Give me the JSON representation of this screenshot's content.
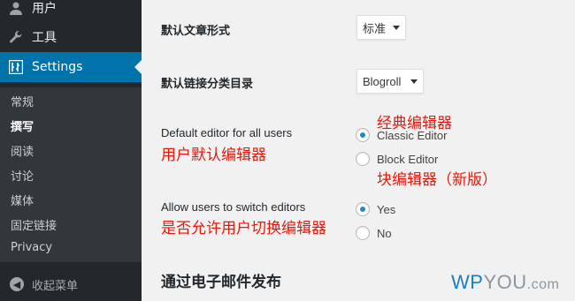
{
  "sidebar": {
    "menu": [
      {
        "label": "用户",
        "icon": "user-icon"
      },
      {
        "label": "工具",
        "icon": "wrench-icon"
      },
      {
        "label": "Settings",
        "icon": "settings-icon"
      }
    ],
    "submenu": [
      "常规",
      "撰写",
      "阅读",
      "讨论",
      "媒体",
      "固定链接",
      "Privacy"
    ],
    "current_submenu": "撰写",
    "collapse_label": "收起菜单"
  },
  "form": {
    "post_format": {
      "label": "默认文章形式",
      "value": "标准"
    },
    "link_category": {
      "label": "默认链接分类目录",
      "value": "Blogroll"
    },
    "default_editor": {
      "label": "Default editor for all users",
      "annotation": "用户默认编辑器",
      "options": [
        {
          "label": "Classic Editor",
          "checked": true,
          "annotation": "经典编辑器"
        },
        {
          "label": "Block Editor",
          "checked": false,
          "annotation": "块编辑器（新版）"
        }
      ]
    },
    "allow_switch": {
      "label": "Allow users to switch editors",
      "annotation": "是否允许用户切换编辑器",
      "options": [
        {
          "label": "Yes",
          "checked": true
        },
        {
          "label": "No",
          "checked": false
        }
      ]
    },
    "email_section_title": "通过电子邮件发布"
  },
  "watermark": {
    "wp": "WP",
    "you": "YOU",
    "com": ".com"
  },
  "colors": {
    "accent": "#0073aa",
    "annotation": "#e8180c",
    "sidebar": "#23282d"
  }
}
